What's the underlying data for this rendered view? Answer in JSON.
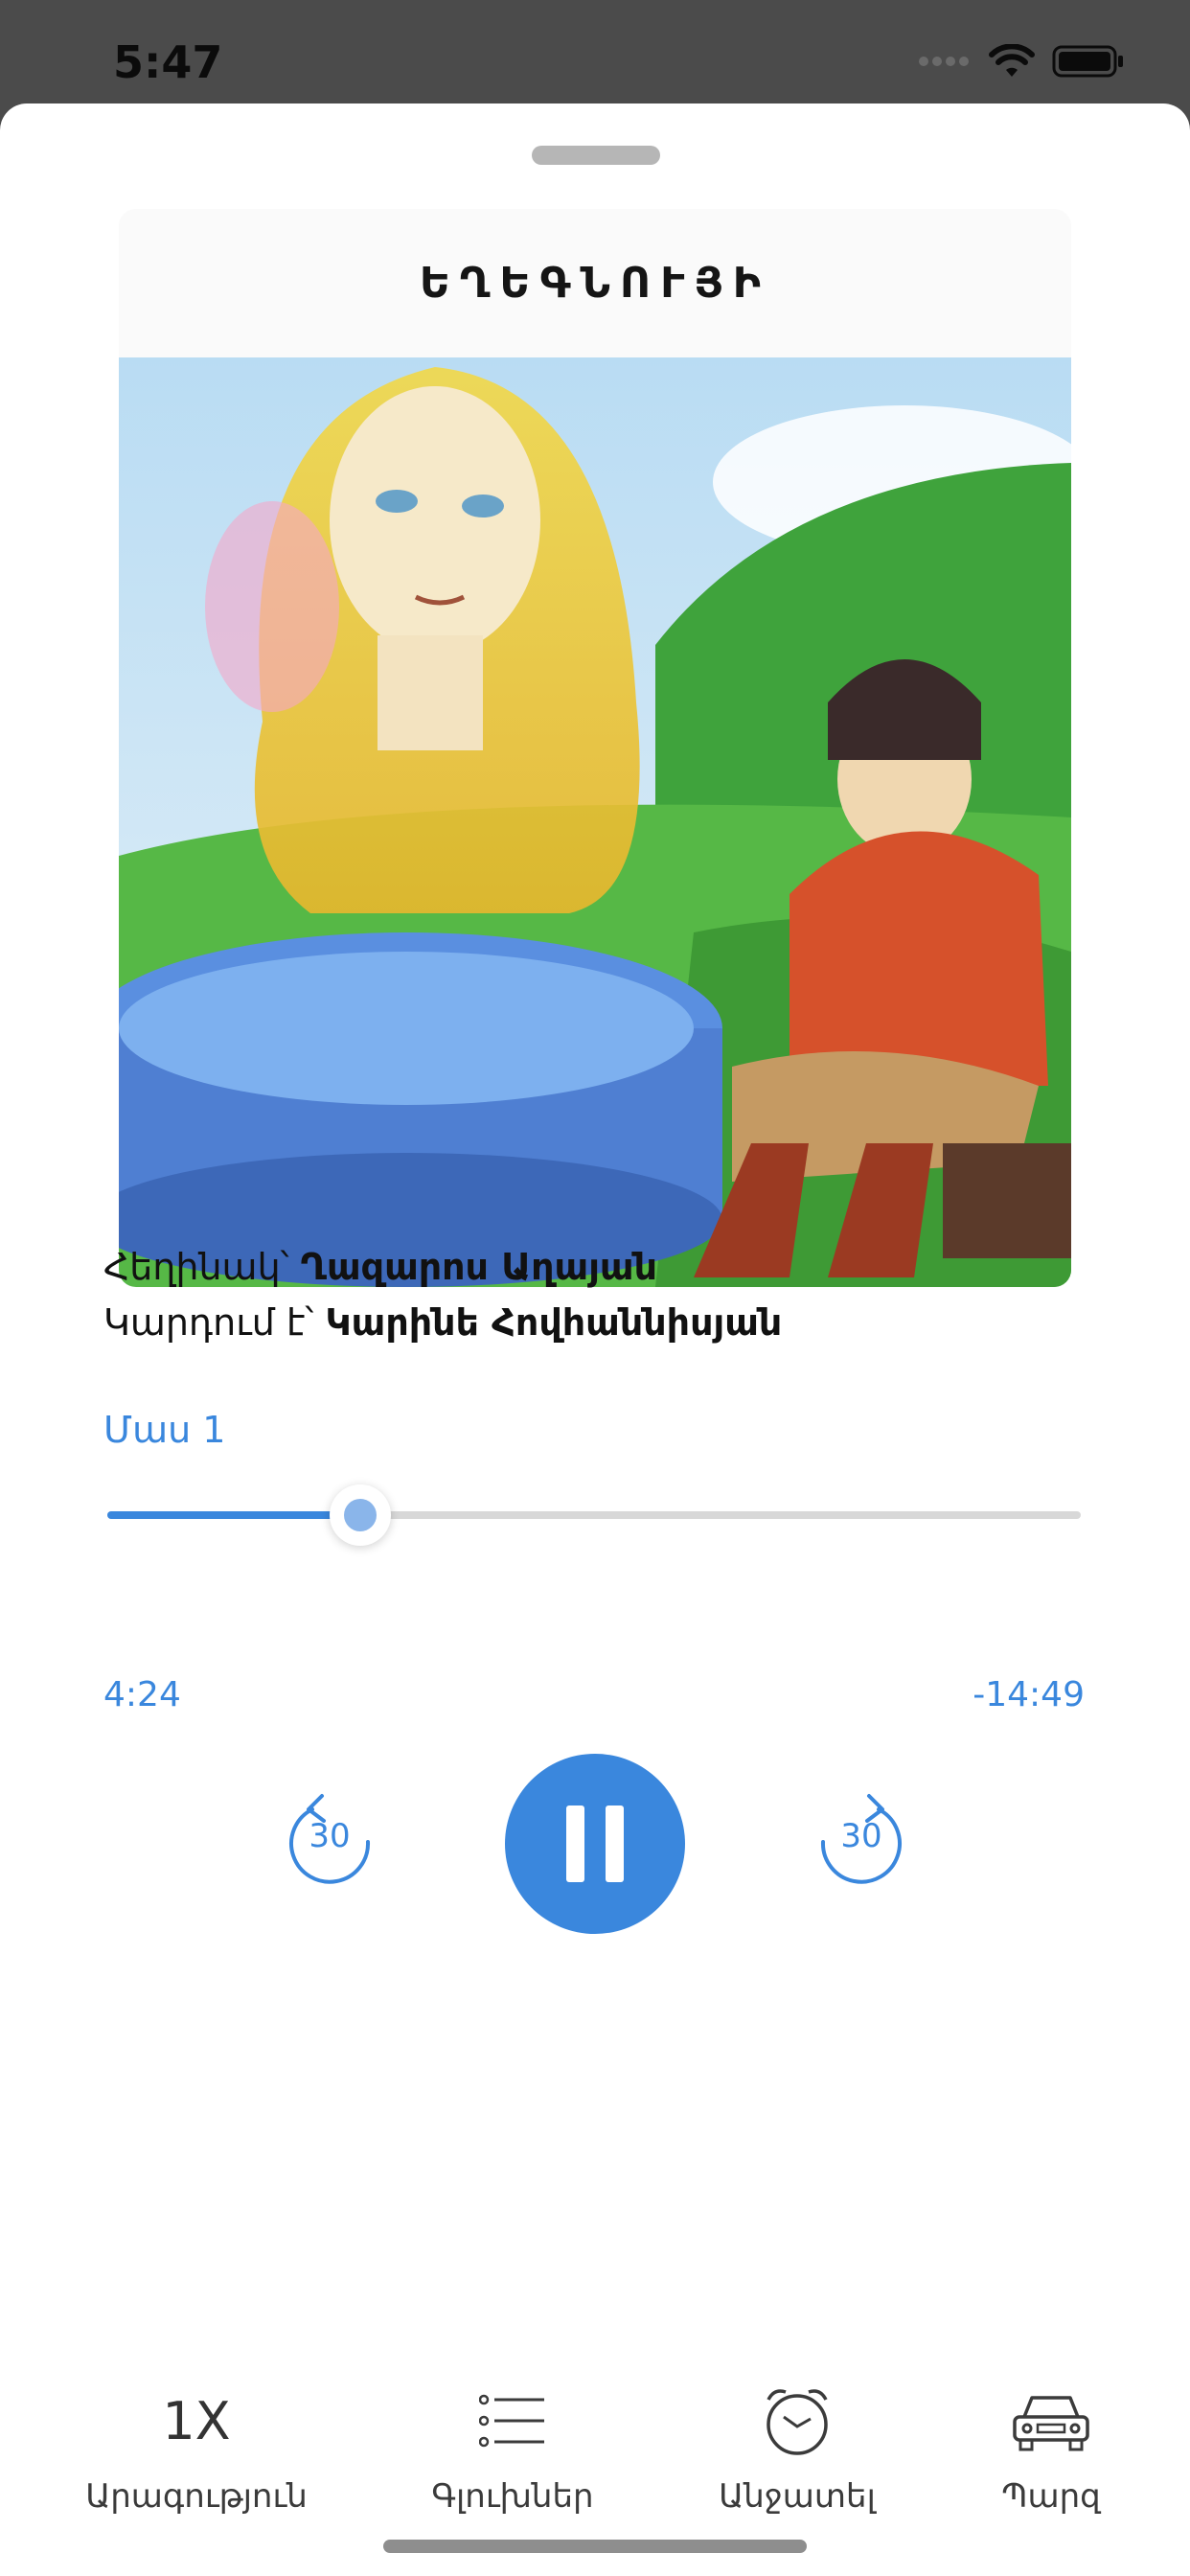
{
  "status_bar": {
    "time": "5:47"
  },
  "cover": {
    "title": "ԵՂԵԳՆՈՒՅԻ"
  },
  "credits": {
    "author_prefix": "Հեղինակ՝ ",
    "author_name": "Ղազարոս Աղայան",
    "reader_prefix": "Կարդում է՝ ",
    "reader_name": "Կարինե Հովհաննիսյան"
  },
  "player": {
    "part_label": "Մաս 1",
    "progress_fraction": 0.26,
    "elapsed": "4:24",
    "remaining": "-14:49",
    "skip_back_seconds": "30",
    "skip_forward_seconds": "30",
    "state": "playing",
    "accent_color": "#3a87dd"
  },
  "toolbar": {
    "items": [
      {
        "icon": "speed-text",
        "icon_text": "1X",
        "label": "Արագություն"
      },
      {
        "icon": "list-icon",
        "label": "Գլուխներ"
      },
      {
        "icon": "alarm-clock-icon",
        "label": "Անջատել"
      },
      {
        "icon": "car-icon",
        "label": "Պարզ"
      }
    ]
  }
}
